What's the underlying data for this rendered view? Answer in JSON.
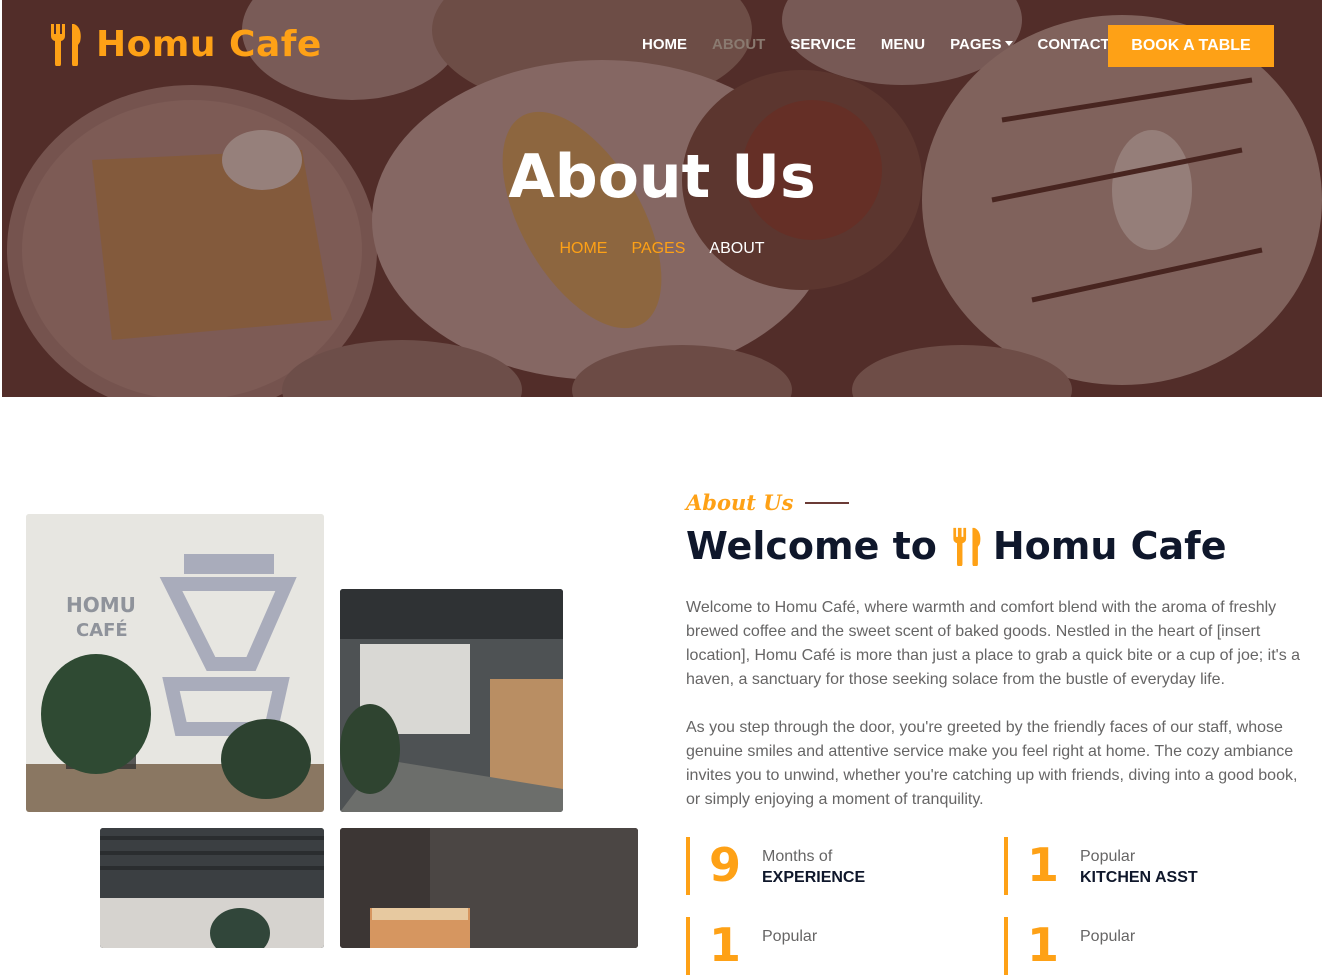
{
  "colors": {
    "primary": "#FEA116",
    "dark": "#0F172B",
    "text": "#666565"
  },
  "brand": {
    "name": "Homu Cafe",
    "icon": "utensils-icon"
  },
  "nav": {
    "items": [
      {
        "label": "Home"
      },
      {
        "label": "About"
      },
      {
        "label": "Service"
      },
      {
        "label": "Menu"
      },
      {
        "label": "Pages"
      },
      {
        "label": "Contact"
      }
    ],
    "cta": "Book A Table"
  },
  "hero": {
    "title": "About Us",
    "breadcrumb": [
      "Home",
      "Pages",
      "About"
    ]
  },
  "about": {
    "subtitle": "About Us",
    "heading_prefix": "Welcome to",
    "heading_brand": "Homu Cafe",
    "paragraphs": [
      "Welcome to Homu Café, where warmth and comfort blend with the aroma of freshly brewed coffee and the sweet scent of baked goods. Nestled in the heart of [insert location], Homu Café is more than just a place to grab a quick bite or a cup of joe; it's a haven, a sanctuary for those seeking solace from the bustle of everyday life.",
      "As you step through the door, you're greeted by the friendly faces of our staff, whose genuine smiles and attentive service make you feel right at home. The cozy ambiance invites you to unwind, whether you're catching up with friends, diving into a good book, or simply enjoying a moment of tranquility."
    ],
    "stats": [
      {
        "number": "9",
        "label": "Months of",
        "strong": "Experience"
      },
      {
        "number": "1",
        "label": "Popular",
        "strong": "Kitchen Asst"
      },
      {
        "number": "1",
        "label": "Popular",
        "strong": ""
      },
      {
        "number": "1",
        "label": "Popular",
        "strong": ""
      }
    ],
    "photos": [
      {
        "alt": "cafe-wall-sign"
      },
      {
        "alt": "cafe-interior"
      },
      {
        "alt": "cafe-seating"
      },
      {
        "alt": "iced-drink"
      }
    ]
  }
}
